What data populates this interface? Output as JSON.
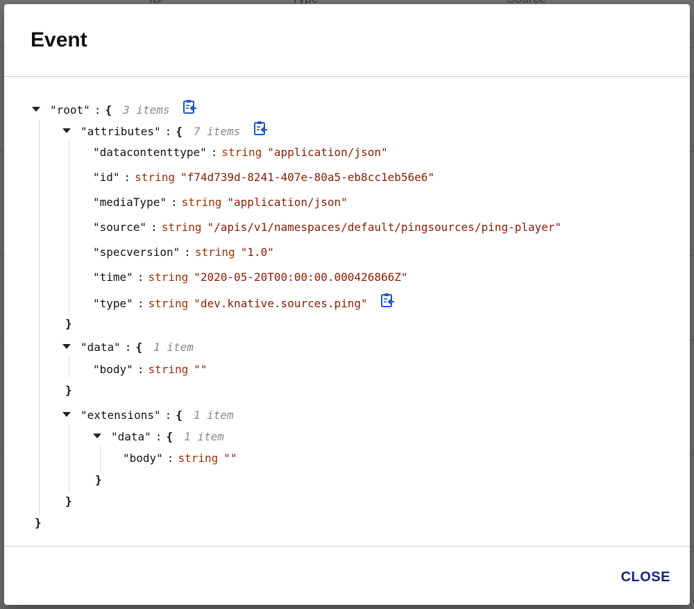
{
  "dialog": {
    "title": "Event",
    "close_label": "CLOSE"
  },
  "background": {
    "header_cells": [
      "ID",
      "Type",
      "Source"
    ]
  },
  "json_tree": {
    "root_key": "\"root\"",
    "root_count": "3 items",
    "attributes_key": "\"attributes\"",
    "attributes_count": "7 items",
    "attributes": [
      {
        "key": "\"datacontenttype\"",
        "type": "string",
        "value": "\"application/json\""
      },
      {
        "key": "\"id\"",
        "type": "string",
        "value": "\"f74d739d-8241-407e-80a5-eb8cc1eb56e6\""
      },
      {
        "key": "\"mediaType\"",
        "type": "string",
        "value": "\"application/json\""
      },
      {
        "key": "\"source\"",
        "type": "string",
        "value": "\"/apis/v1/namespaces/default/pingsources/ping-player\""
      },
      {
        "key": "\"specversion\"",
        "type": "string",
        "value": "\"1.0\""
      },
      {
        "key": "\"time\"",
        "type": "string",
        "value": "\"2020-05-20T00:00:00.000426866Z\""
      },
      {
        "key": "\"type\"",
        "type": "string",
        "value": "\"dev.knative.sources.ping\""
      }
    ],
    "data_key": "\"data\"",
    "data_count": "1 item",
    "data_body_key": "\"body\"",
    "data_body_type": "string",
    "data_body_value": "\"\"",
    "extensions_key": "\"extensions\"",
    "extensions_count": "1 item",
    "ext_data_key": "\"data\"",
    "ext_data_count": "1 item",
    "ext_body_key": "\"body\"",
    "ext_body_type": "string",
    "ext_body_value": "\"\"",
    "open_brace": "{",
    "close_brace": "}",
    "colon": ":"
  },
  "icons": {
    "caret": "caret-down-icon",
    "copy": "copy-to-clipboard-icon"
  },
  "colors": {
    "dialog_title": "#111111",
    "key": "#111111",
    "type": "#a03000",
    "value": "#8b1a00",
    "count": "#888888",
    "close_button": "#1a237e",
    "copy_icon": "#1a56c8"
  }
}
